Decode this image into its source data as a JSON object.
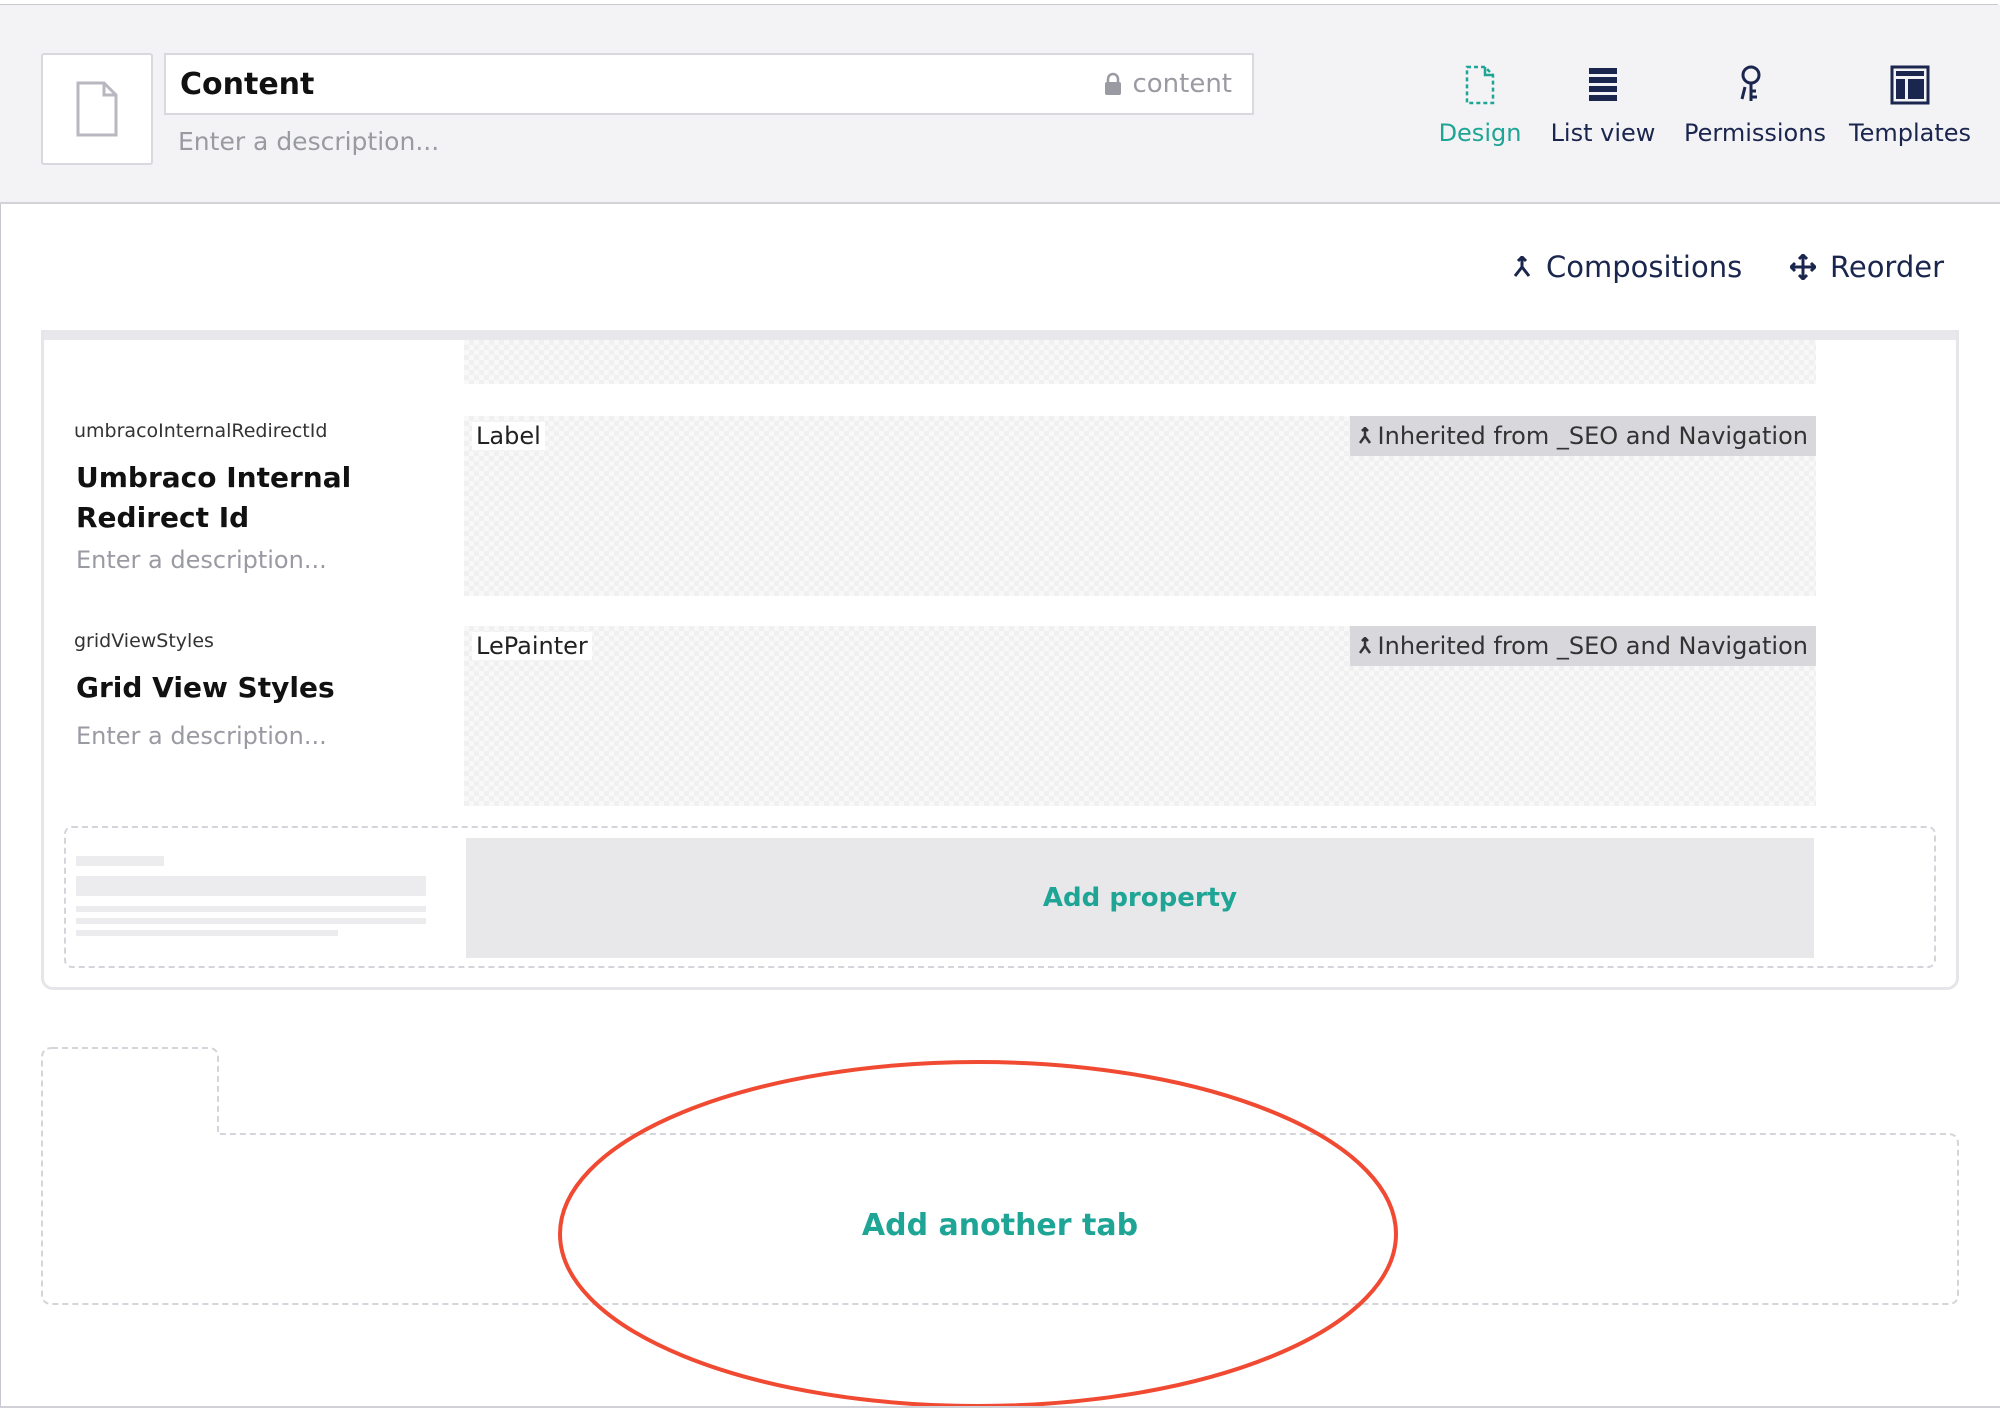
{
  "header": {
    "name_value": "Content",
    "alias_value": "content",
    "description_placeholder": "Enter a description...",
    "nav": [
      {
        "label": "Design",
        "icon": "document-dashed-icon",
        "active": true
      },
      {
        "label": "List view",
        "icon": "list-icon",
        "active": false
      },
      {
        "label": "Permissions",
        "icon": "keys-icon",
        "active": false
      },
      {
        "label": "Templates",
        "icon": "layout-icon",
        "active": false
      }
    ]
  },
  "toolbar": {
    "compositions_label": "Compositions",
    "reorder_label": "Reorder"
  },
  "properties": [
    {
      "alias": "umbracoInternalRedirectId",
      "name": "Umbraco Internal Redirect Id",
      "description_placeholder": "Enter a description...",
      "editor": "Label",
      "inherited": "Inherited from _SEO and Navigation"
    },
    {
      "alias": "gridViewStyles",
      "name": "Grid View Styles",
      "description_placeholder": "Enter a description...",
      "editor": "LePainter",
      "inherited": "Inherited from _SEO and Navigation"
    }
  ],
  "add_property_label": "Add property",
  "add_tab_label": "Add another tab",
  "colors": {
    "accent": "#1ea595",
    "annotation": "#f04a32",
    "text_dark": "#1b264f"
  }
}
